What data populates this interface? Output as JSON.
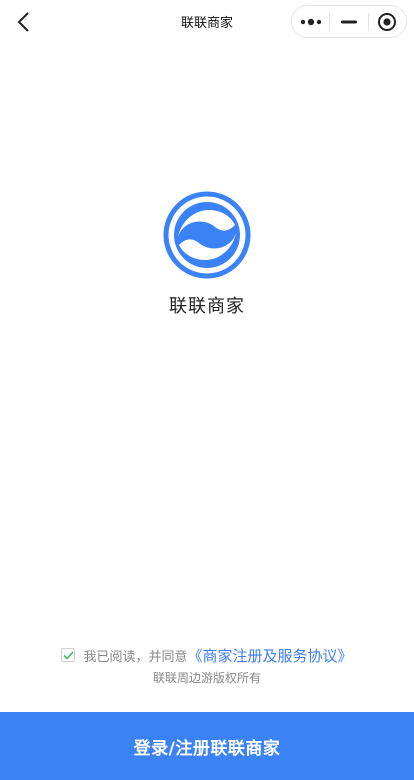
{
  "navbar": {
    "title": "联联商家"
  },
  "icons": {
    "back": "chevron-left-icon",
    "more": "more-dots-icon",
    "minimize": "minimize-icon",
    "close": "target-circle-icon",
    "logo": "brand-logo-icon",
    "check": "check-icon"
  },
  "brand": {
    "name": "联联商家"
  },
  "agreement": {
    "prefix": "我已阅读，并同意",
    "link": "《商家注册及服务协议》",
    "checked": true
  },
  "footer": {
    "copyright": "联联周边游版权所有"
  },
  "actions": {
    "login_label": "登录/注册联联商家"
  },
  "colors": {
    "accent": "#3b82f7",
    "link": "#3e7ef6",
    "check": "#3fb46a"
  }
}
